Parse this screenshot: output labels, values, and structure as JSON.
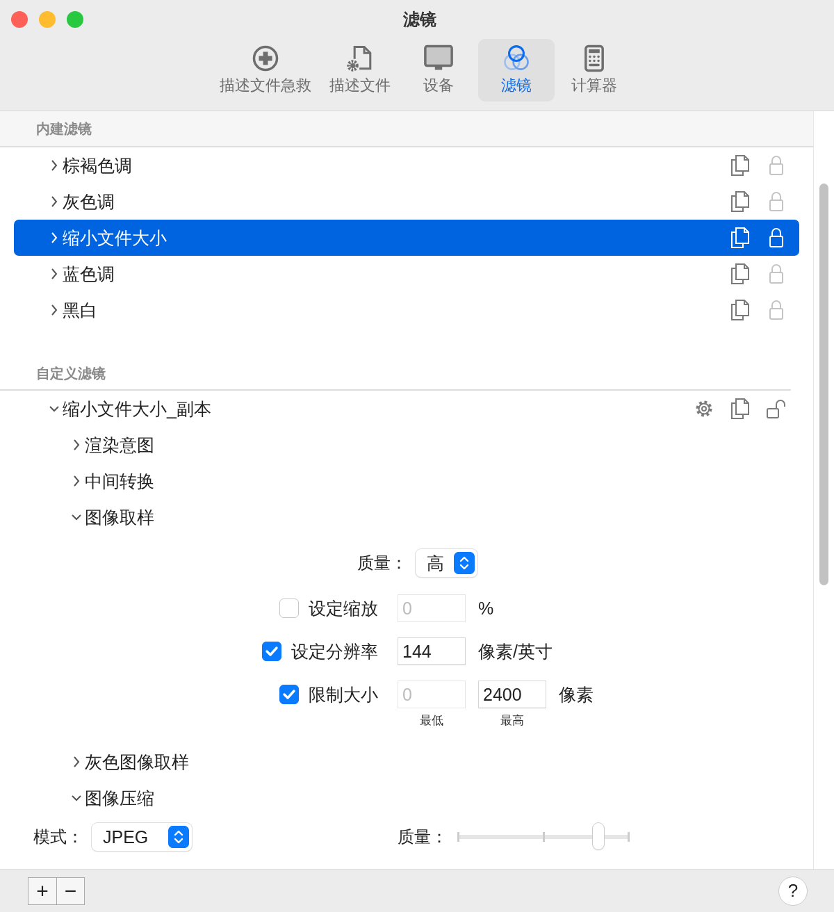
{
  "window": {
    "title": "滤镜"
  },
  "toolbar": [
    {
      "label": "描述文件急救",
      "selected": false
    },
    {
      "label": "描述文件",
      "selected": false
    },
    {
      "label": "设备",
      "selected": false
    },
    {
      "label": "滤镜",
      "selected": true
    },
    {
      "label": "计算器",
      "selected": false
    }
  ],
  "sections": [
    {
      "title": "内建滤镜",
      "items": [
        {
          "kind": "filter",
          "label": "棕褐色调",
          "expanded": false,
          "selected": false,
          "locked": true,
          "editable": false
        },
        {
          "kind": "filter",
          "label": "灰色调",
          "expanded": false,
          "selected": false,
          "locked": true,
          "editable": false
        },
        {
          "kind": "filter",
          "label": "缩小文件大小",
          "expanded": false,
          "selected": true,
          "locked": true,
          "editable": false
        },
        {
          "kind": "filter",
          "label": "蓝色调",
          "expanded": false,
          "selected": false,
          "locked": true,
          "editable": false
        },
        {
          "kind": "filter",
          "label": "黑白",
          "expanded": false,
          "selected": false,
          "locked": true,
          "editable": false
        }
      ]
    },
    {
      "title": "自定义滤镜",
      "items": [
        {
          "kind": "filter",
          "label": "缩小文件大小_副本",
          "expanded": true,
          "selected": false,
          "locked": false,
          "editable": true,
          "children": [
            {
              "kind": "group",
              "label": "渲染意图",
              "expanded": false
            },
            {
              "kind": "group",
              "label": "中间转换",
              "expanded": false
            },
            {
              "kind": "group",
              "label": "图像取样",
              "expanded": true,
              "settings": {
                "kind": "sampling",
                "quality": {
                  "label": "质量：",
                  "value": "高"
                },
                "options": [
                  {
                    "label": "设定缩放",
                    "checked": false,
                    "fields": [
                      {
                        "value": "0",
                        "disabled": true
                      }
                    ],
                    "unit": "%"
                  },
                  {
                    "label": "设定分辨率",
                    "checked": true,
                    "fields": [
                      {
                        "value": "144",
                        "disabled": false
                      }
                    ],
                    "unit": "像素/英寸"
                  },
                  {
                    "label": "限制大小",
                    "checked": true,
                    "fields": [
                      {
                        "value": "0",
                        "disabled": true,
                        "caption": "最低"
                      },
                      {
                        "value": "2400",
                        "disabled": false,
                        "caption": "最高"
                      }
                    ],
                    "unit": "像素"
                  }
                ]
              }
            },
            {
              "kind": "group",
              "label": "灰色图像取样",
              "expanded": false
            },
            {
              "kind": "group",
              "label": "图像压缩",
              "expanded": true,
              "settings": {
                "kind": "compression",
                "mode": {
                  "label": "模式：",
                  "value": "JPEG"
                },
                "quality": {
                  "label": "质量：",
                  "level": 0.82
                }
              }
            }
          ]
        }
      ]
    }
  ],
  "bottom_bar": {
    "add": "+",
    "remove": "−",
    "help": "?"
  }
}
